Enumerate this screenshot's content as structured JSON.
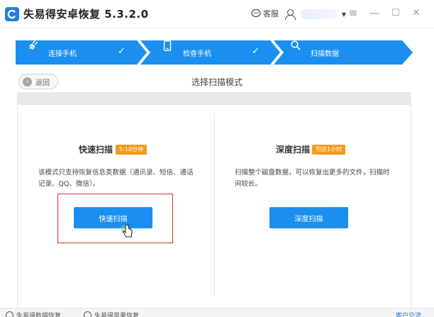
{
  "window": {
    "title": "失易得安卓恢复 5.3.2.0",
    "service_label": "客服",
    "controls": {
      "menu": "≡",
      "minimize": "—",
      "maximize": "☐",
      "close": "✕"
    }
  },
  "stepper": {
    "color": "#1a8ff0",
    "steps": [
      {
        "label": "连接手机",
        "icon": "plug-icon",
        "done": true
      },
      {
        "label": "检查手机",
        "icon": "phone-icon",
        "done": true
      },
      {
        "label": "扫描数据",
        "icon": "search-icon",
        "done": false
      }
    ]
  },
  "mode": {
    "back_label": "返回",
    "title": "选择扫描模式"
  },
  "quick_scan": {
    "title": "快速扫描",
    "badge": "5-10分钟",
    "description_line1": "该模式只支持恢复信息类数据（通讯录、短信、通话",
    "description_line2": "记录、QQ、微信）。",
    "button_label": "快速扫描"
  },
  "deep_scan": {
    "title": "深度扫描",
    "badge": "可达1小时",
    "description_line1": "扫描整个磁盘数据，可以恢复出更多的文件，扫描时",
    "description_line2": "间较长。",
    "button_label": "深度扫描"
  },
  "bottom": {
    "item1": "失易得数据恢复",
    "item2": "失易得苹果恢复",
    "right_link": "客户交流"
  },
  "colors": {
    "accent": "#1a8ff0",
    "badge": "#f39b1c",
    "highlight": "#d9302c"
  }
}
